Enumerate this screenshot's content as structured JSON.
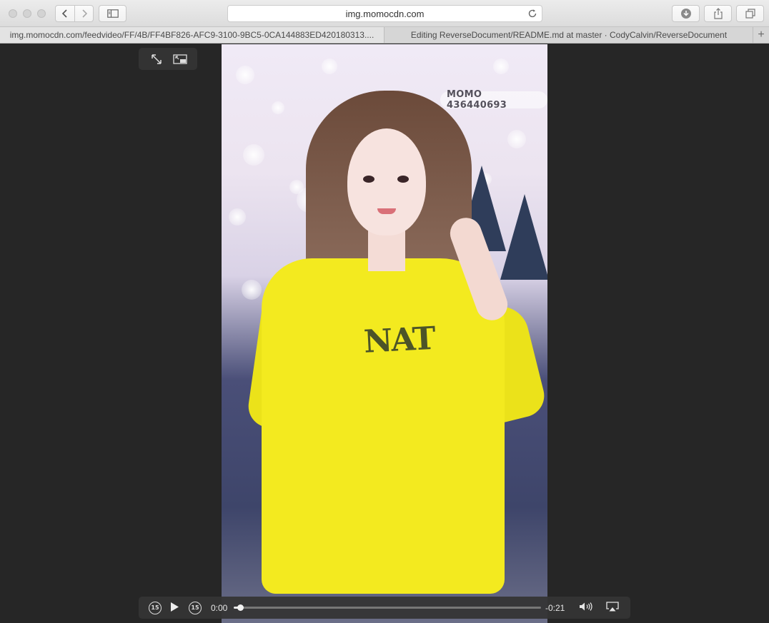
{
  "browser": {
    "address": "img.momocdn.com",
    "tabs": [
      {
        "title": "img.momocdn.com/feedvideo/FF/4B/FF4BF826-AFC9-3100-9BC5-0CA144883ED420180313....",
        "active": true
      },
      {
        "title": "Editing ReverseDocument/README.md at master · CodyCalvin/ReverseDocument",
        "active": false
      }
    ],
    "new_tab": "+"
  },
  "video": {
    "watermark": "MOMO 436440693",
    "shirt_print": "NAT",
    "controls": {
      "skip_back": "15",
      "skip_forward": "15",
      "current_time": "0:00",
      "remaining_time": "-0:21",
      "progress": 0.02
    }
  },
  "icons": [
    "back-icon",
    "forward-icon",
    "sidebar-icon",
    "reload-icon",
    "download-icon",
    "share-icon",
    "tabs-overview-icon",
    "fullscreen-icon",
    "picture-in-picture-icon",
    "skip-back-icon",
    "play-icon",
    "skip-forward-icon",
    "volume-icon",
    "airplay-icon"
  ]
}
